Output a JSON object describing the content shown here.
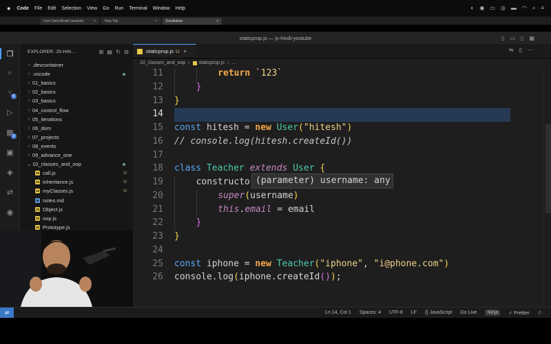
{
  "menubar": {
    "app": "Code",
    "items": [
      "File",
      "Edit",
      "Selection",
      "View",
      "Go",
      "Run",
      "Terminal",
      "Window",
      "Help"
    ]
  },
  "browser_tabs": [
    "User Data Model (avamtot",
    "New Tab",
    "Excalidraw"
  ],
  "window_title": "staticprop.js — js-hindi-youtube",
  "explorer": {
    "title": "EXPLORER: JS-HIN...",
    "items": [
      {
        "label": ".devcontainer",
        "type": "folder",
        "status": ""
      },
      {
        "label": ".vscode",
        "type": "folder",
        "status": "dot"
      },
      {
        "label": "01_basics",
        "type": "folder",
        "status": ""
      },
      {
        "label": "02_basics",
        "type": "folder",
        "status": ""
      },
      {
        "label": "03_basics",
        "type": "folder",
        "status": ""
      },
      {
        "label": "04_control_flow",
        "type": "folder",
        "status": ""
      },
      {
        "label": "05_iterations",
        "type": "folder",
        "status": ""
      },
      {
        "label": "06_dom",
        "type": "folder",
        "status": ""
      },
      {
        "label": "07_projects",
        "type": "folder",
        "status": ""
      },
      {
        "label": "08_events",
        "type": "folder",
        "status": ""
      },
      {
        "label": "09_advance_one",
        "type": "folder",
        "status": ""
      },
      {
        "label": "10_classes_and_oop",
        "type": "folder-open",
        "status": "dot"
      },
      {
        "label": "call.js",
        "type": "js",
        "status": "U"
      },
      {
        "label": "inheritance.js",
        "type": "js",
        "status": "U"
      },
      {
        "label": "myClasses.js",
        "type": "js",
        "status": "U"
      },
      {
        "label": "notes.md",
        "type": "md",
        "status": ""
      },
      {
        "label": "Object.js",
        "type": "js",
        "status": ""
      },
      {
        "label": "oop.js",
        "type": "js",
        "status": ""
      },
      {
        "label": "Prototype.js",
        "type": "js",
        "status": ""
      },
      {
        "label": "staticprop.js",
        "type": "js",
        "status": "U"
      },
      {
        "label": "R...d",
        "type": "info",
        "status": ""
      }
    ]
  },
  "editor_tab": {
    "label": "staticprop.js",
    "status": "U"
  },
  "breadcrumb": {
    "folder": "10_classes_and_oop",
    "file": "staticprop.js",
    "rest": "..."
  },
  "code_lines": [
    {
      "n": "11",
      "indent": 2,
      "html": "<span class=\"kw\">return</span> <span class=\"str\">`123`</span>"
    },
    {
      "n": "12",
      "indent": 1,
      "html": "<span class=\"br2\">}</span>"
    },
    {
      "n": "13",
      "indent": 0,
      "html": "<span class=\"br1\">}</span>"
    },
    {
      "n": "14",
      "indent": 0,
      "html": ""
    },
    {
      "n": "15",
      "indent": 0,
      "html": "<span class=\"kwb\">const</span> hitesh = <span class=\"kw\">new</span> <span class=\"cls\">User</span><span class=\"br1\">(</span><span class=\"str\">\"hitesh\"</span><span class=\"br1\">)</span>"
    },
    {
      "n": "16",
      "indent": 0,
      "html": "<span class=\"cmt\">// console.log(hitesh.createId())</span>"
    },
    {
      "n": "17",
      "indent": 0,
      "html": ""
    },
    {
      "n": "18",
      "indent": 0,
      "html": "<span class=\"kwb\">class</span> <span class=\"cls\">Teacher</span> <span class=\"it\">extends</span> <span class=\"cls\">User</span> <span class=\"br1\">{</span>"
    },
    {
      "n": "19",
      "indent": 1,
      "html": "constructo"
    },
    {
      "n": "20",
      "indent": 2,
      "html": "<span class=\"it\">super</span><span class=\"br1\">(</span>username<span class=\"br1\">)</span>"
    },
    {
      "n": "21",
      "indent": 2,
      "html": "<span class=\"it\">this</span>.<span class=\"it\">email</span> = email"
    },
    {
      "n": "22",
      "indent": 1,
      "html": "<span class=\"br2\">}</span>"
    },
    {
      "n": "23",
      "indent": 0,
      "html": "<span class=\"br1\">}</span>"
    },
    {
      "n": "24",
      "indent": 0,
      "html": ""
    },
    {
      "n": "25",
      "indent": 0,
      "html": "<span class=\"kwb\">const</span> iphone = <span class=\"kw\">new</span> <span class=\"cls\">Teacher</span><span class=\"br1\">(</span><span class=\"str\">\"iphone\"</span>, <span class=\"str\">\"i@phone.com\"</span><span class=\"br1\">)</span>"
    },
    {
      "n": "26",
      "indent": 0,
      "html": "console.log<span class=\"br1\">(</span>iphone.createId<span class=\"br2\">()</span><span class=\"br1\">)</span>;"
    }
  ],
  "current_line": "14",
  "hover_tooltip": "(parameter) username: any",
  "statusbar": {
    "position": "Ln 14, Col 1",
    "spaces": "Spaces: 4",
    "encoding": "UTF-8",
    "eol": "LF",
    "language": "{} JavaScript",
    "golive": "Go Live",
    "ninja": "Ninja",
    "prettier": "✓ Prettier"
  },
  "colors": {
    "accent": "#4a9eff",
    "current_line": "#263a55",
    "selected_row": "#1d3a5b",
    "modified": "#e2c08d"
  }
}
